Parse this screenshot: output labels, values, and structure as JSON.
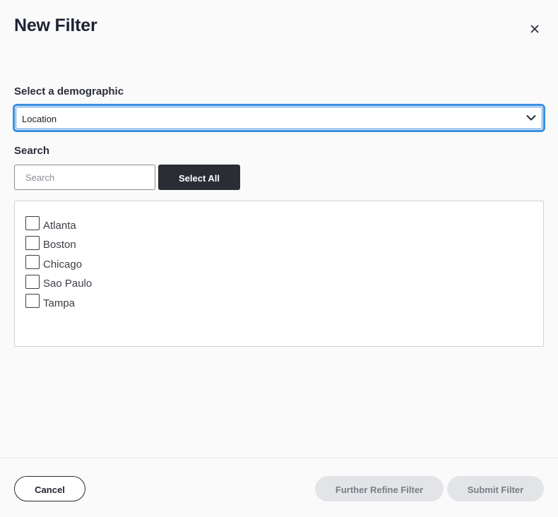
{
  "dialog": {
    "title": "New Filter"
  },
  "demographic": {
    "label": "Select a demographic",
    "selected": "Location"
  },
  "search": {
    "label": "Search",
    "placeholder": "Search",
    "value": "",
    "select_all_label": "Select All"
  },
  "options": [
    {
      "label": "Atlanta",
      "checked": false
    },
    {
      "label": "Boston",
      "checked": false
    },
    {
      "label": "Chicago",
      "checked": false
    },
    {
      "label": "Sao Paulo",
      "checked": false
    },
    {
      "label": "Tampa",
      "checked": false
    }
  ],
  "footer": {
    "cancel_label": "Cancel",
    "refine_label": "Further Refine Filter",
    "submit_label": "Submit Filter"
  },
  "colors": {
    "focus_ring": "#3a8ee0",
    "primary_dark": "#2a2d34",
    "disabled_bg": "#e3e4e7"
  },
  "icons": {
    "close": "close-icon",
    "dropdown": "chevron-down-icon"
  }
}
